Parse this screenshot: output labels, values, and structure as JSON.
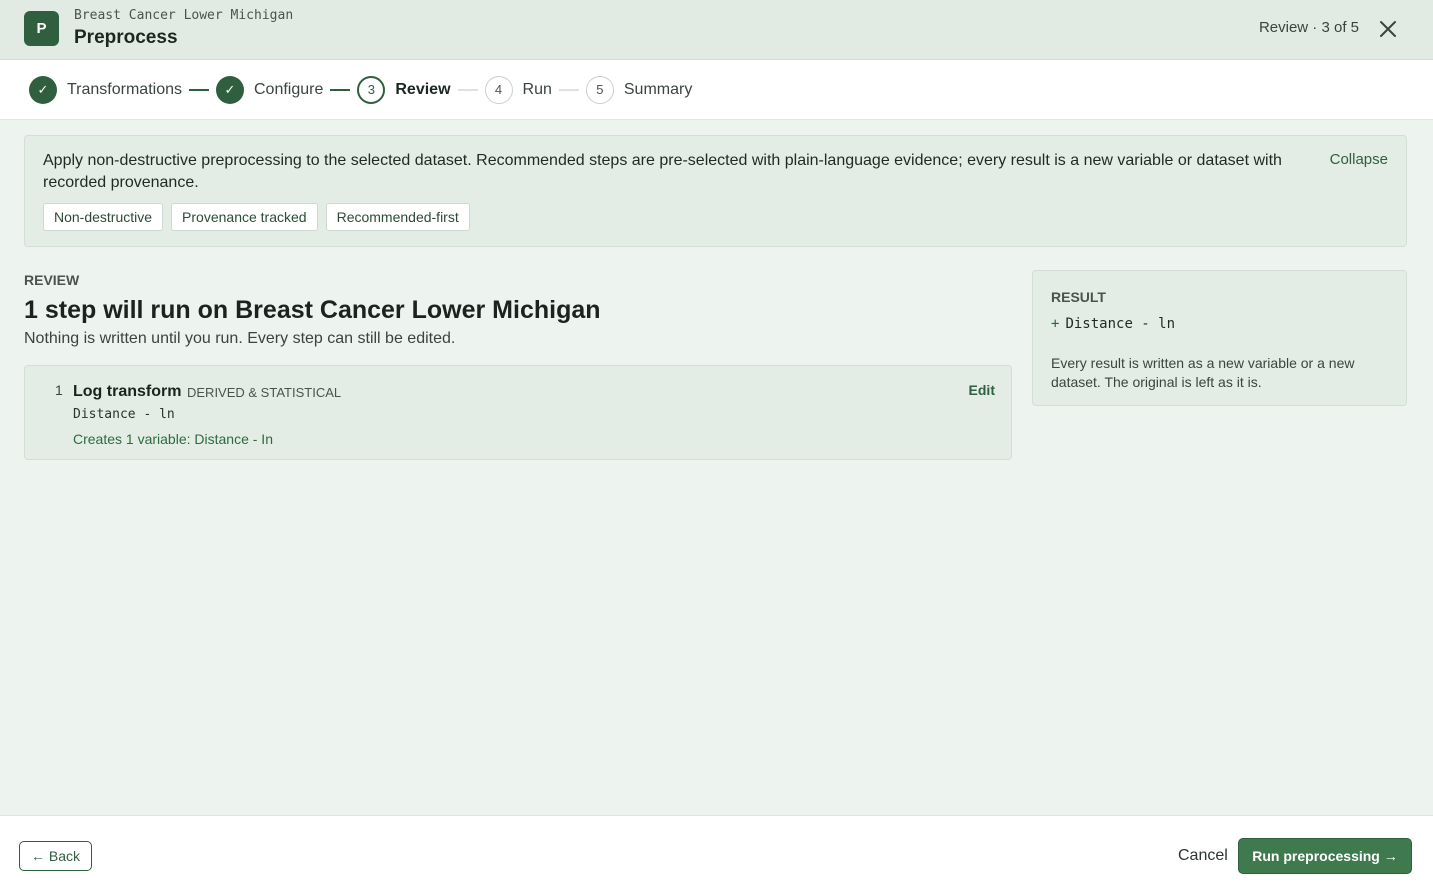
{
  "header": {
    "logo_letter": "P",
    "subtitle": "Breast Cancer Lower Michigan",
    "title": "Preprocess",
    "progress": "Review · 3 of 5",
    "close_icon": "close-icon"
  },
  "stepper": {
    "steps": [
      {
        "marker": "✓",
        "label": "Transformations",
        "state": "done"
      },
      {
        "marker": "✓",
        "label": "Configure",
        "state": "done"
      },
      {
        "marker": "3",
        "label": "Review",
        "state": "current"
      },
      {
        "marker": "4",
        "label": "Run",
        "state": "pending"
      },
      {
        "marker": "5",
        "label": "Summary",
        "state": "pending"
      }
    ]
  },
  "banner": {
    "text": "Apply non-destructive preprocessing to the selected dataset. Recommended steps are pre-selected with plain-language evidence; every result is a new variable or dataset with recorded provenance.",
    "collapse_label": "Collapse",
    "chips": [
      "Non-destructive",
      "Provenance tracked",
      "Recommended-first"
    ]
  },
  "review": {
    "eyebrow": "REVIEW",
    "heading": "1 step will run on Breast Cancer Lower Michigan",
    "note": "Nothing is written until you run. Every step can still be edited.",
    "steps": [
      {
        "number": "1",
        "name": "Log transform",
        "tag": "DERIVED & STATISTICAL",
        "variable": "Distance - ln",
        "creates": "Creates 1 variable: Distance - In",
        "edit_label": "Edit"
      }
    ]
  },
  "result": {
    "title": "RESULT",
    "plus": "+",
    "item": "Distance - ln",
    "note": "Every result is written as a new variable or a new dataset. The original is left as it is."
  },
  "footer": {
    "back_label": "← Back",
    "cancel_label": "Cancel",
    "run_label": "Run preprocessing →"
  },
  "colors": {
    "accent": "#2f5f3e",
    "accent_button": "#3f7a4f",
    "panel_bg": "#e3ede5",
    "page_bg": "#edf3ee"
  }
}
